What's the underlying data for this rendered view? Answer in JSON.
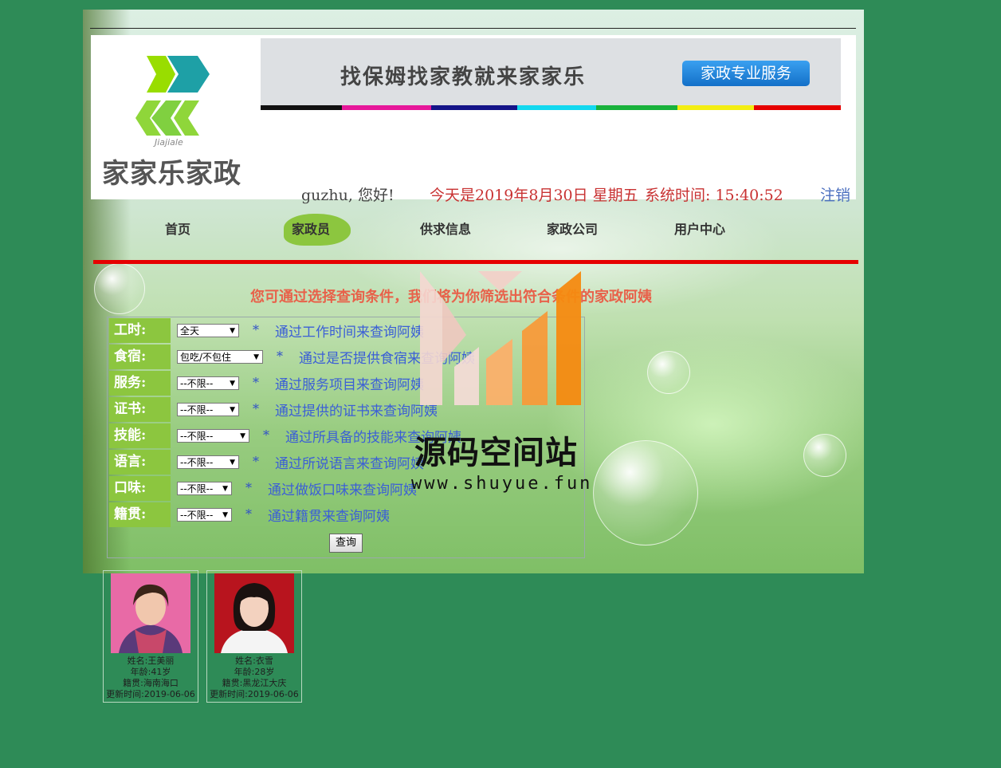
{
  "header": {
    "logo_name": "家家乐家政",
    "logo_sub": "Jiajiale",
    "banner_text": "找保姆找家教就来家家乐",
    "banner_button": "家政专业服务",
    "greeting": "guzhu, 您好!",
    "today": "今天是2019年8月30日  星期五",
    "system_time": "系统时间: 15:40:52",
    "logout": "注销"
  },
  "nav": {
    "items": [
      "首页",
      "家政员",
      "供求信息",
      "家政公司",
      "用户中心"
    ],
    "active": "家政员"
  },
  "search": {
    "intro": "您可通过选择查询条件，我们将为你筛选出符合条件的家政阿姨",
    "rows": [
      {
        "label": "工时:",
        "value": "全天",
        "hint": "通过工作时间来查询阿姨"
      },
      {
        "label": "食宿:",
        "value": "包吃/不包住",
        "hint": "通过是否提供食宿来查询阿姨"
      },
      {
        "label": "服务:",
        "value": "--不限--",
        "hint": "通过服务项目来查询阿姨"
      },
      {
        "label": "证书:",
        "value": "--不限--",
        "hint": "通过提供的证书来查询阿姨"
      },
      {
        "label": "技能:",
        "value": "--不限--",
        "hint": "通过所具备的技能来查询阿姨"
      },
      {
        "label": "语言:",
        "value": "--不限--",
        "hint": "通过所说语言来查询阿姨"
      },
      {
        "label": "口味:",
        "value": "--不限--",
        "hint": "通过做饭口味来查询阿姨"
      },
      {
        "label": "籍贯:",
        "value": "--不限--",
        "hint": "通过籍贯来查询阿姨"
      }
    ],
    "star": "*",
    "query_button": "查询"
  },
  "watermark": {
    "title": "源码空间站",
    "url": "www.shuyue.fun"
  },
  "workers": [
    {
      "name": "姓名:王美丽",
      "age": "年龄:41岁",
      "origin": "籍贯:海南海口",
      "updated": "更新时间:2019-06-06"
    },
    {
      "name": "姓名:衣雪",
      "age": "年龄:28岁",
      "origin": "籍贯:黑龙江大庆",
      "updated": "更新时间:2019-06-06"
    }
  ],
  "colors": {
    "page_bg": "#2e8b57",
    "accent_green": "#8cc63f",
    "nav_underline": "#e60000",
    "intro_text": "#e8614a",
    "hint_text": "#3b5fd6",
    "date_text": "#c83232",
    "banner_stripe": [
      "#111111",
      "#e6179a",
      "#141488",
      "#12d8ef",
      "#18b23c",
      "#f3ee12",
      "#e60000"
    ]
  }
}
